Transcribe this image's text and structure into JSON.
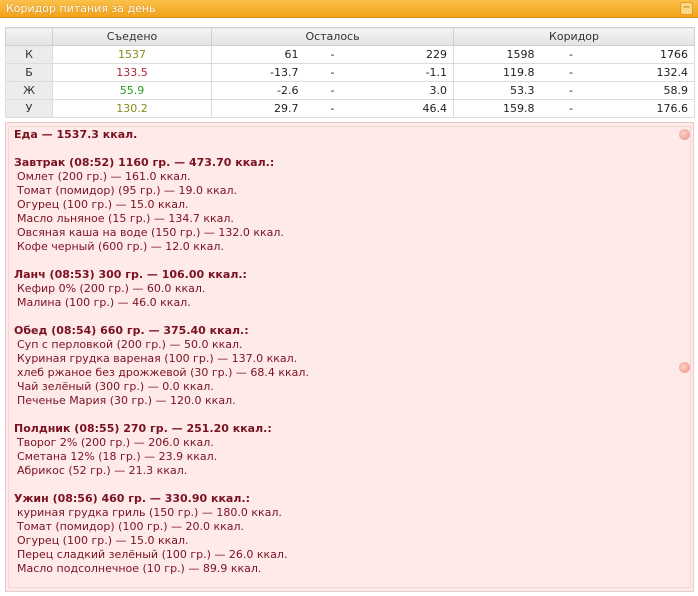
{
  "panel": {
    "title": "Коридор питания за день",
    "collapse_icon": "−"
  },
  "summary": {
    "headers": {
      "eaten": "Съедено",
      "remaining": "Осталось",
      "corridor": "Коридор"
    },
    "rows": [
      {
        "label": "К",
        "eaten": "1537",
        "eaten_color": "#8a8a1a",
        "rem_from": "61",
        "rem_to": "229",
        "cor_from": "1598",
        "cor_to": "1766"
      },
      {
        "label": "Б",
        "eaten": "133.5",
        "eaten_color": "#b0243a",
        "rem_from": "-13.7",
        "rem_to": "-1.1",
        "cor_from": "119.8",
        "cor_to": "132.4"
      },
      {
        "label": "Ж",
        "eaten": "55.9",
        "eaten_color": "#2d9a1e",
        "rem_from": "-2.6",
        "rem_to": "3.0",
        "cor_from": "53.3",
        "cor_to": "58.9"
      },
      {
        "label": "У",
        "eaten": "130.2",
        "eaten_color": "#8a8a1a",
        "rem_from": "29.7",
        "rem_to": "46.4",
        "cor_from": "159.8",
        "cor_to": "176.6"
      }
    ],
    "dash": "-"
  },
  "diary": {
    "total": "Еда — 1537.3 ккал.",
    "meals": [
      {
        "header": "Завтрак (08:52) 1160 гр. — 473.70 ккал.:",
        "items": [
          "Омлет (200 гр.) — 161.0 ккал.",
          "Томат (помидор) (95 гр.) — 19.0 ккал.",
          "Огурец (100 гр.) — 15.0 ккал.",
          "Масло льняное (15 гр.) — 134.7 ккал.",
          "Овсяная каша на воде (150 гр.) — 132.0 ккал.",
          "Кофе черный (600 гр.) — 12.0 ккал."
        ]
      },
      {
        "header": "Ланч (08:53) 300 гр. — 106.00 ккал.:",
        "items": [
          "Кефир 0% (200 гр.) — 60.0 ккал.",
          "Малина (100 гр.) — 46.0 ккал."
        ]
      },
      {
        "header": "Обед (08:54) 660 гр. — 375.40 ккал.:",
        "items": [
          "Суп с перловкой (200 гр.) — 50.0 ккал.",
          "Куриная грудка вареная (100 гр.) — 137.0 ккал.",
          "хлеб ржаное без дрожжевой (30 гр.) — 68.4 ккал.",
          "Чай зелёный (300 гр.) — 0.0 ккал.",
          "Печенье Мария (30 гр.) — 120.0 ккал."
        ]
      },
      {
        "header": "Полдник (08:55) 270 гр. — 251.20 ккал.:",
        "items": [
          "Творог 2% (200 гр.) — 206.0 ккал.",
          "Сметана 12% (18 гр.) — 23.9 ккал.",
          "Абрикос (52 гр.) — 21.3 ккал."
        ]
      },
      {
        "header": "Ужин (08:56) 460 гр. — 330.90 ккал.:",
        "items": [
          "куриная грудка гриль (150 гр.) — 180.0 ккал.",
          "Томат (помидор) (100 гр.) — 20.0 ккал.",
          "Огурец (100 гр.) — 15.0 ккал.",
          "Перец сладкий зелёный (100 гр.) — 26.0 ккал.",
          "Масло подсолнечное (10 гр.) — 89.9 ккал."
        ]
      }
    ]
  }
}
